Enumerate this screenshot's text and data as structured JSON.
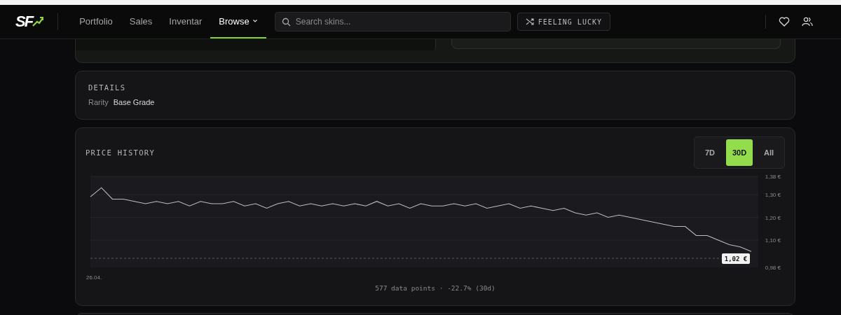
{
  "nav": {
    "logo": "SF",
    "links": [
      {
        "label": "Portfolio",
        "selected": false,
        "dropdown": false
      },
      {
        "label": "Sales",
        "selected": false,
        "dropdown": false
      },
      {
        "label": "Inventar",
        "selected": false,
        "dropdown": false
      },
      {
        "label": "Browse",
        "selected": true,
        "dropdown": true
      }
    ],
    "search": {
      "placeholder": "Search skins..."
    },
    "lucky_button": "FEELING LUCKY"
  },
  "details": {
    "title": "DETAILS",
    "fields": [
      {
        "label": "Rarity",
        "value": "Base Grade"
      }
    ]
  },
  "price_history": {
    "title": "PRICE HISTORY",
    "ranges": [
      {
        "label": "7D",
        "selected": false
      },
      {
        "label": "30D",
        "selected": true
      },
      {
        "label": "All",
        "selected": false
      }
    ],
    "chart_data": {
      "type": "line",
      "ylim": [
        0.98,
        1.38
      ],
      "ref_lines": [
        {
          "axis": "y",
          "value": 1.02,
          "label": "1,02 €"
        }
      ],
      "yticks": [
        {
          "value": 1.38,
          "label": "1,38 €"
        },
        {
          "value": 1.3,
          "label": "1,30 €"
        },
        {
          "value": 1.2,
          "label": "1,20 €"
        },
        {
          "value": 1.1,
          "label": "1,10 €"
        },
        {
          "value": 0.98,
          "label": "0,98 €"
        }
      ],
      "series": [
        {
          "color": "#bdbdc0",
          "values": [
            1.29,
            1.33,
            1.28,
            1.28,
            1.27,
            1.26,
            1.27,
            1.26,
            1.27,
            1.25,
            1.27,
            1.26,
            1.26,
            1.27,
            1.25,
            1.26,
            1.24,
            1.26,
            1.27,
            1.25,
            1.26,
            1.25,
            1.26,
            1.25,
            1.26,
            1.25,
            1.27,
            1.25,
            1.26,
            1.24,
            1.26,
            1.25,
            1.25,
            1.26,
            1.25,
            1.26,
            1.24,
            1.25,
            1.26,
            1.24,
            1.25,
            1.24,
            1.23,
            1.24,
            1.22,
            1.21,
            1.22,
            1.2,
            1.21,
            1.2,
            1.19,
            1.18,
            1.17,
            1.16,
            1.16,
            1.12,
            1.12,
            1.1,
            1.08,
            1.07,
            1.05
          ]
        }
      ]
    },
    "x_start": "26.04.",
    "summary": "577 data points · -22.7% (30d)"
  }
}
